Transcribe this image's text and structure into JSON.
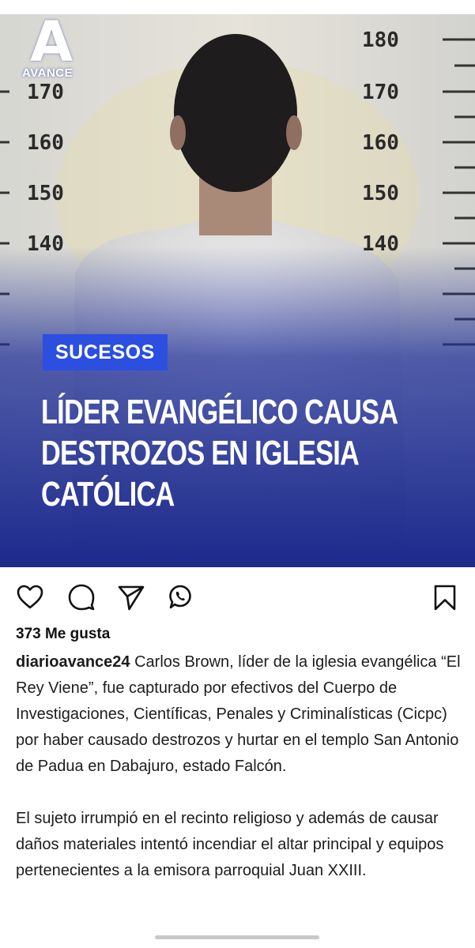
{
  "post": {
    "logo": {
      "letter": "A",
      "word": "AVANCE"
    },
    "category": "SUCESOS",
    "headline_lines": [
      "LÍDER EVANGÉLICO CAUSA",
      "DESTROZOS EN IGLESIA",
      "CATÓLICA"
    ],
    "height_chart_labels": {
      "left": [
        "170",
        "160",
        "150",
        "140"
      ],
      "right": [
        "180",
        "170",
        "160",
        "150",
        "140"
      ]
    }
  },
  "actions": {
    "like": "heart-icon",
    "comment": "comment-icon",
    "share": "send-icon",
    "whatsapp": "whatsapp-icon",
    "save": "bookmark-icon"
  },
  "likes_text": "373 Me gusta",
  "caption": {
    "username": "diarioavance24",
    "paragraph1": "Carlos Brown, líder de la iglesia evangélica “El Rey Viene”, fue capturado por efectivos del Cuerpo de Investigaciones, Científicas, Penales y Criminalísticas (Cicpc) por haber causado destrozos y hurtar en el templo San Antonio de Padua en Dabajuro, estado Falcón.",
    "paragraph2": "El sujeto irrumpió en el recinto religioso y además de causar daños materiales intentó incendiar el altar principal y equipos pertenecientes a la emisora parroquial Juan XXIII."
  },
  "colors": {
    "badge": "#2c4fe0",
    "overlay": "#1f2f8f"
  }
}
